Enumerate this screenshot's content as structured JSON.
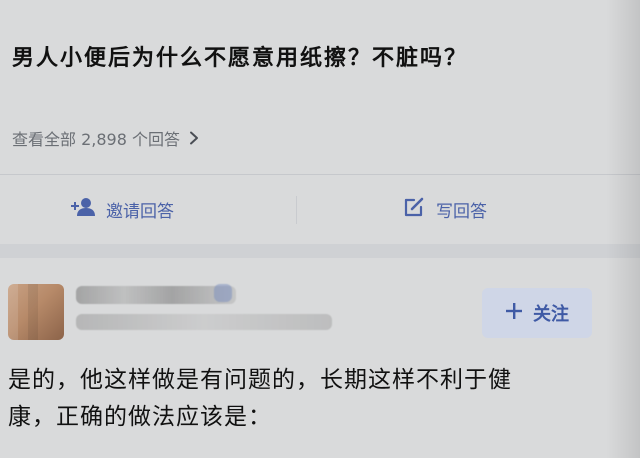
{
  "question": {
    "title": "男人小便后为什么不愿意用纸擦？不脏吗？",
    "view_all_text": "查看全部 2,898 个回答"
  },
  "actions": {
    "invite_label": "邀请回答",
    "write_label": "写回答"
  },
  "author": {
    "follow_label": "关注"
  },
  "answer": {
    "line1": "是的，他这样做是有问题的，长期这样不利于健",
    "line2": "康，正确的做法应该是："
  },
  "colors": {
    "background": "#d9dadb",
    "accent": "#4b62a8",
    "follow_bg": "#cfd6e7",
    "text_primary": "#111111",
    "text_secondary": "#6b6f75"
  }
}
